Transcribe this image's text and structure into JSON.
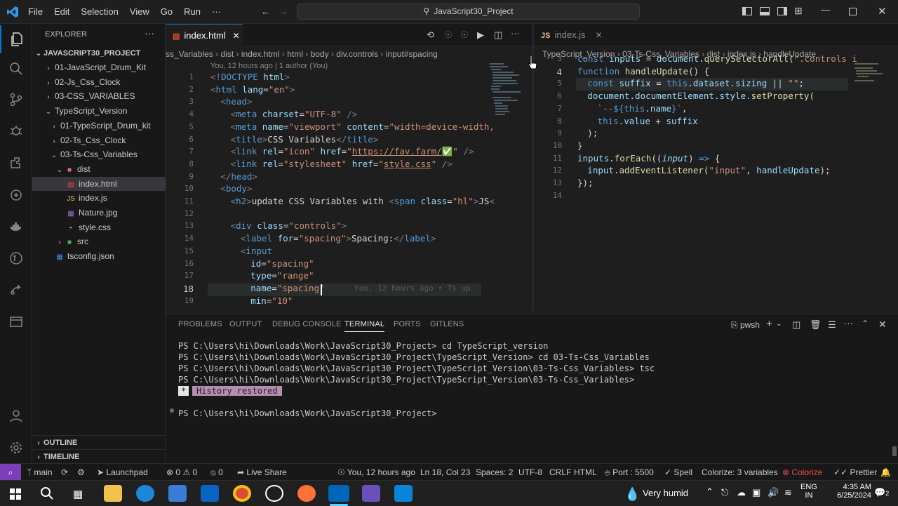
{
  "menu": [
    "File",
    "Edit",
    "Selection",
    "View",
    "Go",
    "Run",
    "···"
  ],
  "search": {
    "text": "JavaScript30_Project"
  },
  "explorer": {
    "title": "EXPLORER",
    "project": "JAVASCRIPT30_PROJECT",
    "items": [
      {
        "label": "01-JavaScript_Drum_Kit",
        "type": "folder",
        "open": false
      },
      {
        "label": "02-Js_Css_Clock",
        "type": "folder",
        "open": false
      },
      {
        "label": "03-CSS_VARIABLES",
        "type": "folder",
        "open": false
      },
      {
        "label": "TypeScript_Version",
        "type": "folder",
        "open": true
      },
      {
        "label": "01-TypeScript_Drum_kit",
        "type": "folder",
        "open": false
      },
      {
        "label": "02-Ts_Css_Clock",
        "type": "folder",
        "open": false
      },
      {
        "label": "03-Ts-Css_Variables",
        "type": "folder",
        "open": true
      },
      {
        "label": "dist",
        "type": "folder",
        "open": true
      },
      {
        "label": "index.html",
        "type": "html",
        "selected": true
      },
      {
        "label": "index.js",
        "type": "js"
      },
      {
        "label": "Nature.jpg",
        "type": "img"
      },
      {
        "label": "style.css",
        "type": "css"
      },
      {
        "label": "src",
        "type": "folder",
        "open": false
      },
      {
        "label": "tsconfig.json",
        "type": "json"
      }
    ],
    "outline": "OUTLINE",
    "timeline": "TIMELINE"
  },
  "editor1": {
    "tab": "index.html",
    "crumbs": [
      "ss_Variables",
      "dist",
      "index.html",
      "html",
      "body",
      "div.controls",
      "input#spacing"
    ],
    "blame": "You, 12 hours ago | 1 author (You)",
    "inline_blame": "You, 12 hours ago • Ts up",
    "lines": [
      {
        "n": "1",
        "html": "<span class='gy'>&lt;!</span><span class='tg'>DOCTYPE</span> <span class='at'>html</span><span class='gy'>&gt;</span>",
        "indent": 0
      },
      {
        "n": "2",
        "html": "<span class='gy'>&lt;</span><span class='tg'>html</span> <span class='at'>lang</span>=<span class='st'>\"en\"</span><span class='gy'>&gt;</span>",
        "indent": 0
      },
      {
        "n": "3",
        "html": "<span class='gy'>&lt;</span><span class='tg'>head</span><span class='gy'>&gt;</span>",
        "indent": 1
      },
      {
        "n": "4",
        "html": "<span class='gy'>&lt;</span><span class='tg'>meta</span> <span class='at'>charset</span>=<span class='st'>\"UTF-8\"</span> <span class='gy'>/&gt;</span>",
        "indent": 2
      },
      {
        "n": "5",
        "html": "<span class='gy'>&lt;</span><span class='tg'>meta</span> <span class='at'>name</span>=<span class='st'>\"viewport\"</span> <span class='at'>content</span>=<span class='st'>\"width=device-width,</span>",
        "indent": 2
      },
      {
        "n": "6",
        "html": "<span class='gy'>&lt;</span><span class='tg'>title</span><span class='gy'>&gt;</span>CSS Variables<span class='gy'>&lt;/</span><span class='tg'>title</span><span class='gy'>&gt;</span>",
        "indent": 2
      },
      {
        "n": "7",
        "html": "<span class='gy'>&lt;</span><span class='tg'>link</span> <span class='at'>rel</span>=<span class='st'>\"icon\"</span> <span class='at'>href</span>=<span class='st'>\"</span><span class='lk'>https://fav.farm/</span><span style='color:#3fb950'>✅</span><span class='st'>\"</span> <span class='gy'>/&gt;</span>",
        "indent": 2
      },
      {
        "n": "8",
        "html": "<span class='gy'>&lt;</span><span class='tg'>link</span> <span class='at'>rel</span>=<span class='st'>\"stylesheet\"</span> <span class='at'>href</span>=<span class='st'>\"</span><span class='lk'>style.css</span><span class='st'>\"</span> <span class='gy'>/&gt;</span>",
        "indent": 2
      },
      {
        "n": "9",
        "html": "<span class='gy'>&lt;/</span><span class='tg'>head</span><span class='gy'>&gt;</span>",
        "indent": 1
      },
      {
        "n": "10",
        "html": "<span class='gy'>&lt;</span><span class='tg'>body</span><span class='gy'>&gt;</span>",
        "indent": 1
      },
      {
        "n": "11",
        "html": "<span class='gy'>&lt;</span><span class='tg'>h2</span><span class='gy'>&gt;</span>update CSS Variables with <span class='gy'>&lt;</span><span class='tg'>span</span> <span class='at'>class</span>=<span class='st'>\"hl\"</span><span class='gy'>&gt;</span>JS<span class='gy'>&lt;</span>",
        "indent": 2
      },
      {
        "n": "12",
        "html": "",
        "indent": 0
      },
      {
        "n": "13",
        "html": "<span class='gy'>&lt;</span><span class='tg'>div</span> <span class='at'>class</span>=<span class='st'>\"controls\"</span><span class='gy'>&gt;</span>",
        "indent": 2
      },
      {
        "n": "14",
        "html": "<span class='gy'>&lt;</span><span class='tg'>label</span> <span class='at'>for</span>=<span class='st'>\"spacing\"</span><span class='gy'>&gt;</span>Spacing:<span class='gy'>&lt;/</span><span class='tg'>label</span><span class='gy'>&gt;</span>",
        "indent": 3
      },
      {
        "n": "15",
        "html": "<span class='gy'>&lt;</span><span class='tg'>input</span>",
        "indent": 3
      },
      {
        "n": "16",
        "html": "<span class='at'>id</span>=<span class='st'>\"spacing\"</span>",
        "indent": 4
      },
      {
        "n": "17",
        "html": "<span class='at'>type</span>=<span class='st'>\"range\"</span>",
        "indent": 4
      },
      {
        "n": "18",
        "html": "<span class='at'>name</span>=<span class='st'>\"spacing\"</span>",
        "indent": 4
      },
      {
        "n": "19",
        "html": "<span class='at'>min</span>=<span class='st'>\"10\"</span>",
        "indent": 4
      }
    ]
  },
  "editor2": {
    "tab": "index.js",
    "crumbs": [
      "TypeScript_Version",
      "03-Ts-Css_Variables",
      "dist",
      "index.js",
      "handleUpdate"
    ],
    "lines": [
      {
        "n": "3",
        "html": "<span class='kb'>const</span> <span class='vr'>inputs</span> = <span class='vr'>document</span>.<span class='fn'>querySelectorAll</span>(<span class='st'>\".controls i</span>",
        "indent": 0
      },
      {
        "n": "4",
        "html": "<span class='kb'>function</span> <span class='fn'>handleUpdate</span>() {",
        "indent": 0
      },
      {
        "n": "5",
        "html": "<span class='kb'>const</span> <span class='vr'>suffix</span> = <span class='kb'>this</span>.<span class='vr'>dataset</span>.<span class='vr'>sizing</span> || <span class='st'>\"\"</span>;",
        "indent": 1
      },
      {
        "n": "6",
        "html": "<span class='vr'>document</span>.<span class='vr'>documentElement</span>.<span class='vr'>style</span>.<span class='fn'>setProperty</span>(",
        "indent": 1
      },
      {
        "n": "7",
        "html": "<span class='st'>`--</span><span class='kb'>${</span><span class='kb'>this</span>.<span class='vr'>name</span><span class='kb'>}</span><span class='st'>`</span>,",
        "indent": 2
      },
      {
        "n": "8",
        "html": "<span class='kb'>this</span>.<span class='vr'>value</span> + <span class='vr'>suffix</span>",
        "indent": 2
      },
      {
        "n": "9",
        "html": ");",
        "indent": 1
      },
      {
        "n": "10",
        "html": "}",
        "indent": 0
      },
      {
        "n": "11",
        "html": "<span class='vr'>inputs</span>.<span class='fn'>forEach</span>((<span class='vr'><i>input</i></span>) <span class='kb'>=&gt;</span> {",
        "indent": 0
      },
      {
        "n": "12",
        "html": "<span class='vr'>input</span>.<span class='fn'>addEventListener</span>(<span class='st'>\"input\"</span>, <span class='vr'>handleUpdate</span>);",
        "indent": 1
      },
      {
        "n": "13",
        "html": "});",
        "indent": 0
      },
      {
        "n": "14",
        "html": "",
        "indent": 0
      }
    ]
  },
  "panel": {
    "tabs": [
      "PROBLEMS",
      "OUTPUT",
      "DEBUG CONSOLE",
      "TERMINAL",
      "PORTS",
      "GITLENS"
    ],
    "active": "TERMINAL",
    "shell": "pwsh",
    "lines": [
      "PS C:\\Users\\hi\\Downloads\\Work\\JavaScript30_Project> cd TypeScript_version",
      "PS C:\\Users\\hi\\Downloads\\Work\\JavaScript30_Project\\TypeScript_Version> cd 03-Ts-Css_Variables",
      "PS C:\\Users\\hi\\Downloads\\Work\\JavaScript30_Project\\TypeScript_Version\\03-Ts-Css_Variables> tsc",
      "PS C:\\Users\\hi\\Downloads\\Work\\JavaScript30_Project\\TypeScript_Version\\03-Ts-Css_Variables>"
    ],
    "history_star": "*",
    "history": "History restored",
    "prompt": "PS C:\\Users\\hi\\Downloads\\Work\\JavaScript30_Project>"
  },
  "status": {
    "branch": "main",
    "launchpad": "Launchpad",
    "errors": "0",
    "warnings": "0",
    "ports": "0",
    "liveshare": "Live Share",
    "blame": "You, 12 hours ago",
    "position": "Ln 18, Col 23",
    "spaces": "Spaces: 2",
    "encoding": "UTF-8",
    "eol": "CRLF",
    "lang": "HTML",
    "port": "Port : 5500",
    "spell": "Spell",
    "colorize": "Colorize: 3 variables",
    "colorize2": "Colorize",
    "prettier": "Prettier"
  },
  "taskbar": {
    "weather": "Very humid",
    "lang1": "ENG",
    "lang2": "IN",
    "time": "4:35 AM",
    "date": "6/25/2024",
    "notif": "2"
  },
  "colors": {
    "accent": "#0078d4",
    "selection": "#37373d",
    "remote": "#7a3fb8"
  }
}
